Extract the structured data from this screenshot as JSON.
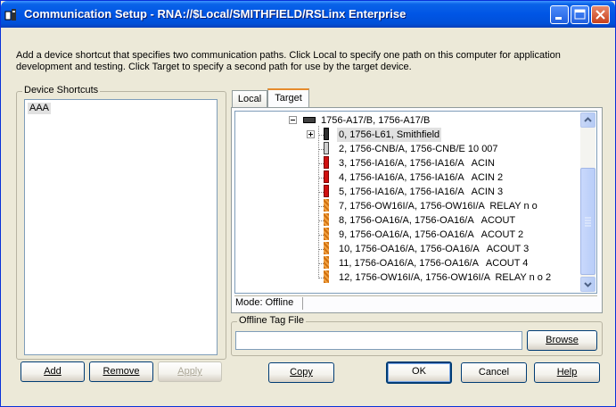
{
  "window": {
    "title": "Communication Setup - RNA://$Local/SMITHFIELD/RSLinx Enterprise"
  },
  "description": "Add a device shortcut that specifies two communication paths. Click Local to specify one path on this computer for application\ndevelopment and testing. Click Target to specify a second path for use by the target device.",
  "device_shortcuts": {
    "label": "Device Shortcuts",
    "items": [
      "AAA"
    ],
    "selected": "AAA"
  },
  "left_buttons": {
    "add": "Add",
    "remove": "Remove",
    "apply": "Apply"
  },
  "tabs": {
    "local": "Local",
    "target": "Target",
    "active": "Target"
  },
  "tree": {
    "root": "1756-A17/B, 1756-A17/B",
    "items": [
      "0, 1756-L61, Smithfield",
      "2, 1756-CNB/A, 1756-CNB/E 10 007",
      "3, 1756-IA16/A, 1756-IA16/A   ACIN",
      "4, 1756-IA16/A, 1756-IA16/A   ACIN 2",
      "5, 1756-IA16/A, 1756-IA16/A   ACIN 3",
      "7, 1756-OW16I/A, 1756-OW16I/A  RELAY n o",
      "8, 1756-OA16/A, 1756-OA16/A   ACOUT",
      "9, 1756-OA16/A, 1756-OA16/A   ACOUT 2",
      "10, 1756-OA16/A, 1756-OA16/A   ACOUT 3",
      "11, 1756-OA16/A, 1756-OA16/A   ACOUT 4",
      "12, 1756-OW16I/A, 1756-OW16I/A  RELAY n o 2"
    ],
    "item_icons": [
      "black",
      "gray",
      "red",
      "red",
      "red",
      "orange",
      "orange",
      "orange",
      "orange",
      "orange",
      "orange"
    ]
  },
  "status": {
    "mode": "Mode: Offline"
  },
  "offline_tag_file": {
    "label": "Offline Tag File",
    "value": "",
    "browse": "Browse"
  },
  "bottom_buttons": {
    "copy": "Copy",
    "ok": "OK",
    "cancel": "Cancel",
    "help": "Help"
  },
  "colors": {
    "titlebar": "#0055e5",
    "dialog_bg": "#ece9d8",
    "tab_accent": "#e68b2c"
  }
}
